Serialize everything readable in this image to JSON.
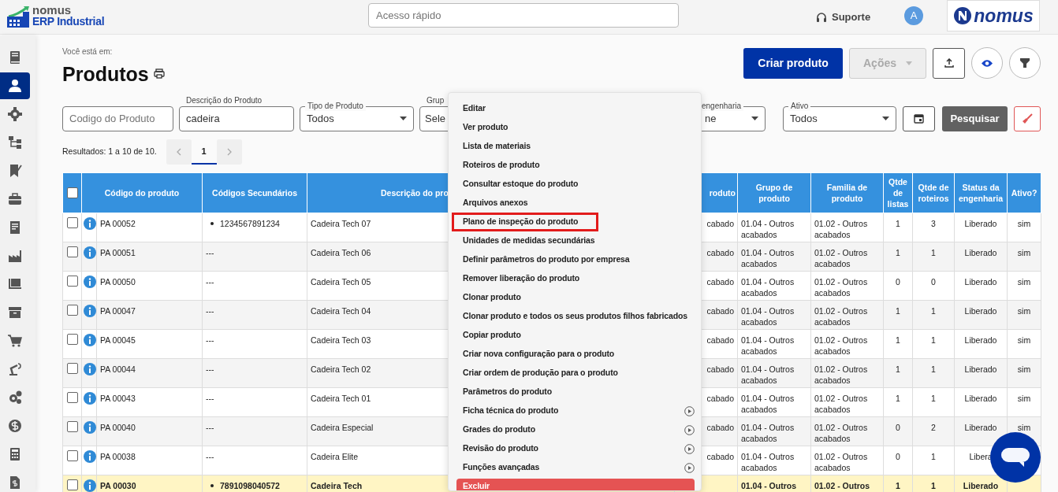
{
  "topbar": {
    "brand": "nomus",
    "brand_sub": "ERP Industrial",
    "search": {
      "placeholder": "Acesso rápido"
    },
    "support": "Suporte",
    "avatar": "A",
    "logo_text": "nomus"
  },
  "sidebar": {
    "items": [
      {
        "selected": false
      },
      {
        "selected": true
      },
      {
        "selected": false
      },
      {
        "selected": false
      },
      {
        "selected": false
      },
      {
        "selected": false
      },
      {
        "selected": false
      },
      {
        "selected": false
      },
      {
        "selected": false
      },
      {
        "selected": false
      },
      {
        "selected": false
      },
      {
        "selected": false
      },
      {
        "selected": false
      },
      {
        "selected": false
      },
      {
        "selected": false
      },
      {
        "selected": false
      }
    ]
  },
  "breadcrumb": "Você está em:",
  "title": "Produtos",
  "actions": {
    "primary": "Criar produto",
    "secondary": {
      "label": "Ações",
      "disabled": true
    }
  },
  "filters": [
    {
      "kind": "text",
      "placeholder": "Codigo do Produto"
    },
    {
      "kind": "text",
      "label": "Descrição do Produto",
      "value": "cadeira"
    },
    {
      "kind": "select",
      "label": "Tipo de Produto",
      "value": "Todos"
    },
    {
      "kind": "text",
      "label": "Grup",
      "value": "Sele"
    },
    {
      "kind": "select",
      "label": "engenharia",
      "value": "ne"
    },
    {
      "kind": "select",
      "label": "Ativo",
      "value": "Todos"
    }
  ],
  "search_button": "Pesquisar",
  "results": "Resultados: 1 a 10 de 10.",
  "pagination": {
    "pages": [
      {
        "label": "1",
        "selected": true
      }
    ]
  },
  "table": {
    "all_selected": false,
    "columns": [
      "Código do produto",
      "Códigos Secundários",
      "Descrição do pro",
      "roduto",
      "Grupo de produto",
      "Familia de produto",
      "Qtde de listas",
      "Qtde de roteiros",
      "Status da engenharia",
      "Ativo?"
    ],
    "rows": [
      {
        "selected": false,
        "highlighted": false,
        "cells": [
          "PA 00052",
          "1234567891234",
          "Cadeira Tech 07",
          "cabado",
          "01.04 - Outros acabados",
          "01.02 - Outros acabados",
          "1",
          "3",
          "Liberado",
          "sim"
        ],
        "secondary_list": true
      },
      {
        "selected": false,
        "highlighted": false,
        "cells": [
          "PA 00051",
          "---",
          "Cadeira Tech 06",
          "cabado",
          "01.04 - Outros acabados",
          "01.02 - Outros acabados",
          "1",
          "1",
          "Liberado",
          "sim"
        ],
        "secondary_list": false
      },
      {
        "selected": false,
        "highlighted": false,
        "cells": [
          "PA 00050",
          "---",
          "Cadeira Tech 05",
          "cabado",
          "01.04 - Outros acabados",
          "01.02 - Outros acabados",
          "0",
          "0",
          "Liberado",
          "sim"
        ],
        "secondary_list": false
      },
      {
        "selected": false,
        "highlighted": false,
        "cells": [
          "PA 00047",
          "---",
          "Cadeira Tech 04",
          "cabado",
          "01.04 - Outros acabados",
          "01.02 - Outros acabados",
          "1",
          "1",
          "Liberado",
          "sim"
        ],
        "secondary_list": false
      },
      {
        "selected": false,
        "highlighted": false,
        "cells": [
          "PA 00045",
          "---",
          "Cadeira Tech 03",
          "cabado",
          "01.04 - Outros acabados",
          "01.02 - Outros acabados",
          "1",
          "1",
          "Liberado",
          "sim"
        ],
        "secondary_list": false
      },
      {
        "selected": false,
        "highlighted": false,
        "cells": [
          "PA 00044",
          "---",
          "Cadeira Tech 02",
          "cabado",
          "01.04 - Outros acabados",
          "01.02 - Outros acabados",
          "1",
          "1",
          "Liberado",
          "sim"
        ],
        "secondary_list": false
      },
      {
        "selected": false,
        "highlighted": false,
        "cells": [
          "PA 00043",
          "---",
          "Cadeira Tech 01",
          "cabado",
          "01.04 - Outros acabados",
          "01.02 - Outros acabados",
          "1",
          "1",
          "Liberado",
          "sim"
        ],
        "secondary_list": false
      },
      {
        "selected": false,
        "highlighted": false,
        "cells": [
          "PA 00040",
          "---",
          "Cadeira Especial",
          "cabado",
          "01.04 - Outros acabados",
          "01.02 - Outros acabados",
          "0",
          "2",
          "Liberado",
          "sim"
        ],
        "secondary_list": false
      },
      {
        "selected": false,
        "highlighted": false,
        "cells": [
          "PA 00038",
          "---",
          "Cadeira Elite",
          "cabado",
          "01.04 - Outros acabados",
          "01.02 - Outros acabados",
          "0",
          "1",
          "Libera",
          ""
        ],
        "secondary_list": false
      },
      {
        "selected": false,
        "highlighted": true,
        "cells": [
          "PA 00030",
          "7891098040572",
          "Cadeira Tech",
          "",
          "01.04 - Outros",
          "01.02 - Outros",
          "1",
          "1",
          "Liberado",
          ""
        ],
        "secondary_list": true
      }
    ]
  },
  "context_menu": [
    {
      "label": "Editar",
      "kind": "action",
      "highlighted": false
    },
    {
      "label": "Ver produto",
      "kind": "action",
      "highlighted": false
    },
    {
      "label": "Lista de materiais",
      "kind": "action",
      "highlighted": false
    },
    {
      "label": "Roteiros de produto",
      "kind": "action",
      "highlighted": false
    },
    {
      "label": "Consultar estoque do produto",
      "kind": "action",
      "highlighted": false
    },
    {
      "label": "Arquivos anexos",
      "kind": "action",
      "highlighted": false
    },
    {
      "label": "Plano de inspeção do produto",
      "kind": "action",
      "highlighted": true
    },
    {
      "label": "Unidades de medidas secundárias",
      "kind": "action",
      "highlighted": false
    },
    {
      "label": "Definir parâmetros do produto por empresa",
      "kind": "action",
      "highlighted": false
    },
    {
      "label": "Remover liberação do produto",
      "kind": "action",
      "highlighted": false
    },
    {
      "label": "Clonar produto",
      "kind": "action",
      "highlighted": false
    },
    {
      "label": "Clonar produto e todos os seus produtos filhos fabricados",
      "kind": "action",
      "highlighted": false
    },
    {
      "label": "Copiar produto",
      "kind": "action",
      "highlighted": false
    },
    {
      "label": "Criar nova configuração para o produto",
      "kind": "action",
      "highlighted": false
    },
    {
      "label": "Criar ordem de produção para o produto",
      "kind": "action",
      "highlighted": false
    },
    {
      "label": "Parâmetros do produto",
      "kind": "action",
      "highlighted": false
    },
    {
      "label": "Ficha técnica do produto",
      "kind": "submenu",
      "highlighted": false
    },
    {
      "label": "Grades do produto",
      "kind": "submenu",
      "highlighted": false
    },
    {
      "label": "Revisão do produto",
      "kind": "submenu",
      "highlighted": false
    },
    {
      "label": "Funções avançadas",
      "kind": "submenu",
      "highlighted": false
    },
    {
      "label": "Excluir",
      "kind": "danger",
      "highlighted": false
    }
  ]
}
